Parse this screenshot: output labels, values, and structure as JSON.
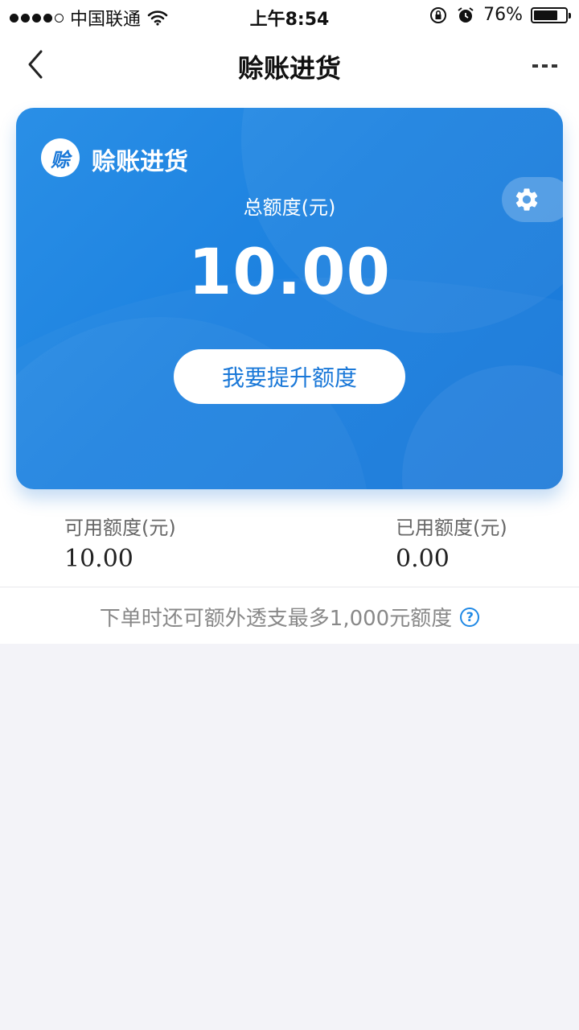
{
  "status_bar": {
    "carrier": "中国联通",
    "time": "上午8:54",
    "battery_percent": "76%",
    "battery_level": 0.76,
    "icons": [
      "signal-icon",
      "wifi-icon",
      "orientation-lock-icon",
      "alarm-icon",
      "battery-icon"
    ]
  },
  "nav": {
    "title": "赊账进货",
    "back_icon": "chevron-left-icon",
    "more_icon": "more-icon"
  },
  "card": {
    "logo_char": "赊",
    "brand": "赊账进货",
    "total_label": "总额度(元)",
    "total_value": "10.00",
    "raise_button": "我要提升额度",
    "settings_icon": "gear-icon",
    "accent_color": "#1a78d8"
  },
  "stats": {
    "available_label": "可用额度(元)",
    "available_value": "10.00",
    "used_label": "已用额度(元)",
    "used_value": "0.00"
  },
  "overdraft": {
    "text": "下单时还可额外透支最多1,000元额度",
    "help_icon": "help-circle-icon"
  }
}
